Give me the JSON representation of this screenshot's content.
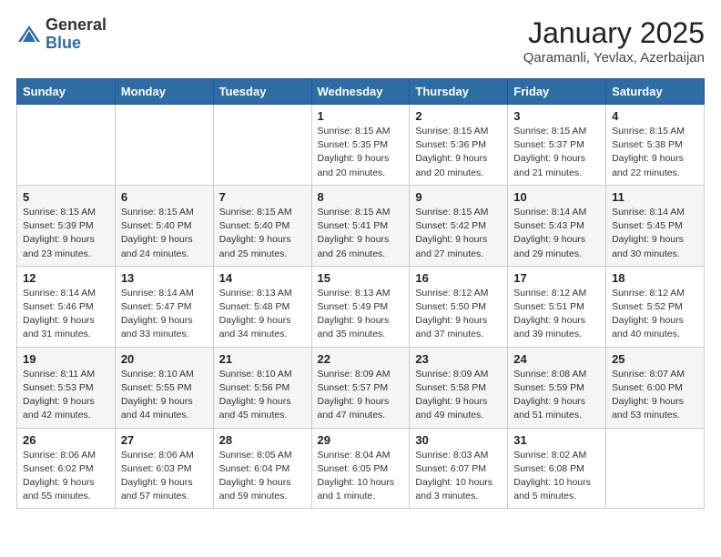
{
  "logo": {
    "general": "General",
    "blue": "Blue"
  },
  "title": "January 2025",
  "subtitle": "Qaramanli, Yevlax, Azerbaijan",
  "days_of_week": [
    "Sunday",
    "Monday",
    "Tuesday",
    "Wednesday",
    "Thursday",
    "Friday",
    "Saturday"
  ],
  "weeks": [
    [
      {
        "num": "",
        "info": ""
      },
      {
        "num": "",
        "info": ""
      },
      {
        "num": "",
        "info": ""
      },
      {
        "num": "1",
        "info": "Sunrise: 8:15 AM\nSunset: 5:35 PM\nDaylight: 9 hours\nand 20 minutes."
      },
      {
        "num": "2",
        "info": "Sunrise: 8:15 AM\nSunset: 5:36 PM\nDaylight: 9 hours\nand 20 minutes."
      },
      {
        "num": "3",
        "info": "Sunrise: 8:15 AM\nSunset: 5:37 PM\nDaylight: 9 hours\nand 21 minutes."
      },
      {
        "num": "4",
        "info": "Sunrise: 8:15 AM\nSunset: 5:38 PM\nDaylight: 9 hours\nand 22 minutes."
      }
    ],
    [
      {
        "num": "5",
        "info": "Sunrise: 8:15 AM\nSunset: 5:39 PM\nDaylight: 9 hours\nand 23 minutes."
      },
      {
        "num": "6",
        "info": "Sunrise: 8:15 AM\nSunset: 5:40 PM\nDaylight: 9 hours\nand 24 minutes."
      },
      {
        "num": "7",
        "info": "Sunrise: 8:15 AM\nSunset: 5:40 PM\nDaylight: 9 hours\nand 25 minutes."
      },
      {
        "num": "8",
        "info": "Sunrise: 8:15 AM\nSunset: 5:41 PM\nDaylight: 9 hours\nand 26 minutes."
      },
      {
        "num": "9",
        "info": "Sunrise: 8:15 AM\nSunset: 5:42 PM\nDaylight: 9 hours\nand 27 minutes."
      },
      {
        "num": "10",
        "info": "Sunrise: 8:14 AM\nSunset: 5:43 PM\nDaylight: 9 hours\nand 29 minutes."
      },
      {
        "num": "11",
        "info": "Sunrise: 8:14 AM\nSunset: 5:45 PM\nDaylight: 9 hours\nand 30 minutes."
      }
    ],
    [
      {
        "num": "12",
        "info": "Sunrise: 8:14 AM\nSunset: 5:46 PM\nDaylight: 9 hours\nand 31 minutes."
      },
      {
        "num": "13",
        "info": "Sunrise: 8:14 AM\nSunset: 5:47 PM\nDaylight: 9 hours\nand 33 minutes."
      },
      {
        "num": "14",
        "info": "Sunrise: 8:13 AM\nSunset: 5:48 PM\nDaylight: 9 hours\nand 34 minutes."
      },
      {
        "num": "15",
        "info": "Sunrise: 8:13 AM\nSunset: 5:49 PM\nDaylight: 9 hours\nand 35 minutes."
      },
      {
        "num": "16",
        "info": "Sunrise: 8:12 AM\nSunset: 5:50 PM\nDaylight: 9 hours\nand 37 minutes."
      },
      {
        "num": "17",
        "info": "Sunrise: 8:12 AM\nSunset: 5:51 PM\nDaylight: 9 hours\nand 39 minutes."
      },
      {
        "num": "18",
        "info": "Sunrise: 8:12 AM\nSunset: 5:52 PM\nDaylight: 9 hours\nand 40 minutes."
      }
    ],
    [
      {
        "num": "19",
        "info": "Sunrise: 8:11 AM\nSunset: 5:53 PM\nDaylight: 9 hours\nand 42 minutes."
      },
      {
        "num": "20",
        "info": "Sunrise: 8:10 AM\nSunset: 5:55 PM\nDaylight: 9 hours\nand 44 minutes."
      },
      {
        "num": "21",
        "info": "Sunrise: 8:10 AM\nSunset: 5:56 PM\nDaylight: 9 hours\nand 45 minutes."
      },
      {
        "num": "22",
        "info": "Sunrise: 8:09 AM\nSunset: 5:57 PM\nDaylight: 9 hours\nand 47 minutes."
      },
      {
        "num": "23",
        "info": "Sunrise: 8:09 AM\nSunset: 5:58 PM\nDaylight: 9 hours\nand 49 minutes."
      },
      {
        "num": "24",
        "info": "Sunrise: 8:08 AM\nSunset: 5:59 PM\nDaylight: 9 hours\nand 51 minutes."
      },
      {
        "num": "25",
        "info": "Sunrise: 8:07 AM\nSunset: 6:00 PM\nDaylight: 9 hours\nand 53 minutes."
      }
    ],
    [
      {
        "num": "26",
        "info": "Sunrise: 8:06 AM\nSunset: 6:02 PM\nDaylight: 9 hours\nand 55 minutes."
      },
      {
        "num": "27",
        "info": "Sunrise: 8:06 AM\nSunset: 6:03 PM\nDaylight: 9 hours\nand 57 minutes."
      },
      {
        "num": "28",
        "info": "Sunrise: 8:05 AM\nSunset: 6:04 PM\nDaylight: 9 hours\nand 59 minutes."
      },
      {
        "num": "29",
        "info": "Sunrise: 8:04 AM\nSunset: 6:05 PM\nDaylight: 10 hours\nand 1 minute."
      },
      {
        "num": "30",
        "info": "Sunrise: 8:03 AM\nSunset: 6:07 PM\nDaylight: 10 hours\nand 3 minutes."
      },
      {
        "num": "31",
        "info": "Sunrise: 8:02 AM\nSunset: 6:08 PM\nDaylight: 10 hours\nand 5 minutes."
      },
      {
        "num": "",
        "info": ""
      }
    ]
  ]
}
